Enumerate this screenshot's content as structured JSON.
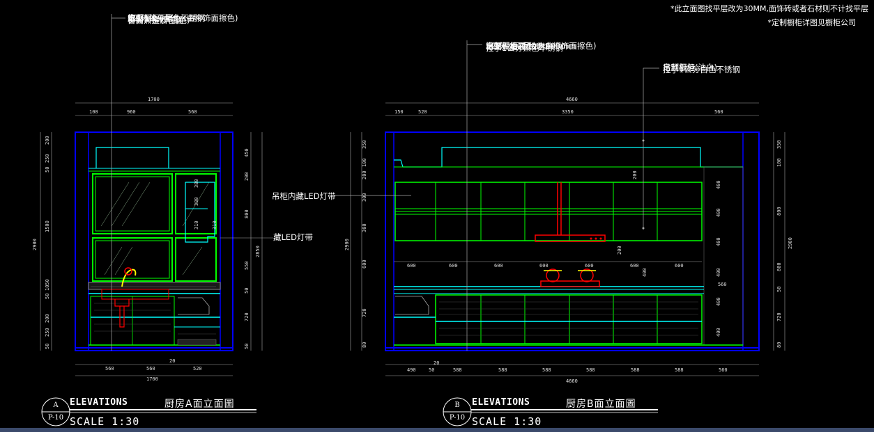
{
  "notes": {
    "line1": "*此立面图找平层改为30MM,面饰砖或者石材则不计找平层",
    "line2": "*定制橱柜详图见橱柜公司"
  },
  "elevation_a": {
    "leaders": [
      "原窗",
      "窗台黑金沙包面",
      "台面人造石(白色)",
      "拉手1公分黑色不锈钢",
      "定制橱柜(直纹水曲柳饰面擦色)",
      "5公分找平层"
    ],
    "callout_led1": "吊柜内藏LED灯带",
    "callout_led2": "藏LED灯带",
    "top_total": "1700",
    "top_parts": [
      "100",
      "960",
      "560"
    ],
    "bottom_parts": [
      "560",
      "560",
      "520"
    ],
    "bottom_small": "20",
    "bottom_total": "1700",
    "left_total": "2900",
    "left_parts": [
      "200",
      "250",
      "50",
      "1500",
      "1050",
      "50",
      "200",
      "250",
      "50"
    ],
    "right_total": "2850",
    "right_parts": [
      "450",
      "200",
      "800",
      "550",
      "50",
      "720",
      "50"
    ],
    "inner_dims": [
      "380",
      "380",
      "310",
      "310"
    ],
    "tag_letter": "A",
    "tag_sheet": "P-10",
    "label": "ELEVATIONS",
    "title": "厨房A面立面圖",
    "scale": "SCALE  1:30"
  },
  "elevation_b": {
    "leaders": [
      "墙面贴墙砖400*600mm",
      "台面人造石(白色)",
      "拉手1公分黑色不锈钢",
      "定制橱柜(直纹水曲柳饰面擦色)",
      "5公分找平层"
    ],
    "leaders_right": [
      "吊顶部分",
      "拉手1公分白色不锈钢",
      "定制橱柜(油白)"
    ],
    "top_total": "4660",
    "top_parts": [
      "150",
      "520",
      "3350",
      "560"
    ],
    "bottom_parts": [
      "490",
      "50",
      "588",
      "588",
      "588",
      "588",
      "588",
      "588",
      "560"
    ],
    "bottom_small": "20",
    "bottom_total": "4660",
    "mid_dims": [
      "600",
      "600",
      "600",
      "600",
      "600",
      "600",
      "600"
    ],
    "left_total": "2900",
    "left_parts": [
      "350",
      "100",
      "200",
      "300",
      "300",
      "600",
      "720",
      "80"
    ],
    "right_total": "2900",
    "right_parts": [
      "350",
      "100",
      "800",
      "800",
      "50",
      "720",
      "80"
    ],
    "inner_dims": [
      "200",
      "200",
      "400",
      "400",
      "400",
      "400",
      "400",
      "400",
      "560",
      "400"
    ],
    "tag_letter": "B",
    "tag_sheet": "P-10",
    "label": "ELEVATIONS",
    "title": "厨房B面立面圖",
    "scale": "SCALE  1:30"
  },
  "colors": {
    "frame": "#0000ff",
    "cabinet": "#00ff00",
    "outline": "#00ffff",
    "appliance": "#ff0000",
    "accent": "#ffff00"
  }
}
